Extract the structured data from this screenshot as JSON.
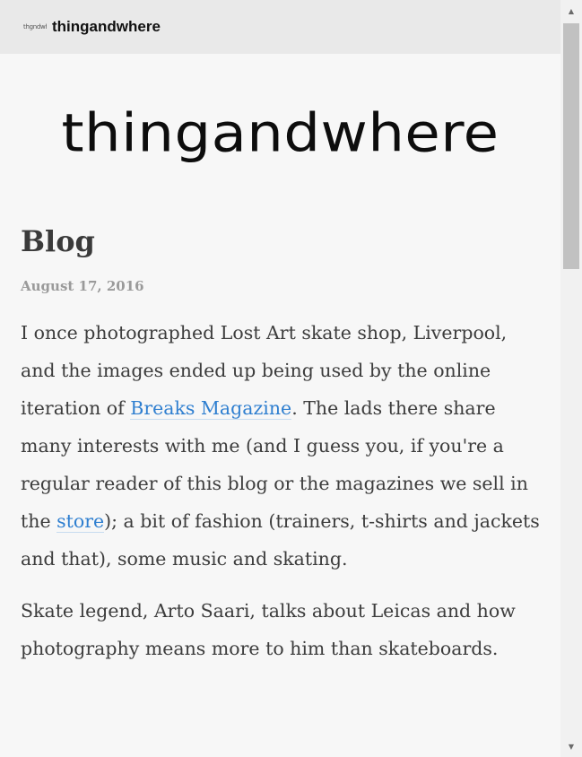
{
  "header": {
    "favicon_text": "thgndwhre",
    "site_name": "thingandwhere"
  },
  "logo": {
    "text": "thingandwhere"
  },
  "page": {
    "title": "Blog"
  },
  "post": {
    "date": "August 17, 2016",
    "p1_before": "I once photographed Lost Art skate shop, Liverpool, and the images ended up being used by the online iteration of ",
    "link_breaks": "Breaks Magazine",
    "p1_middle": ". The lads there share many interests with me (and I guess you, if you're a regular reader of this blog or the magazines we sell in the ",
    "link_store": "store",
    "p1_after": "); a bit of fashion (trainers, t-shirts and jackets and that), some music and skating.",
    "p2": "Skate legend, Arto Saari, talks about Leicas and how photography means more to him than skateboards."
  },
  "scrollbar": {
    "up_icon": "triangle-up-icon",
    "down_icon": "triangle-down-icon",
    "position_fraction": 0
  },
  "colors": {
    "link": "#2f7fd0",
    "text": "#3d3d3d",
    "date": "#9a9a9a",
    "header_bg": "#e9e9e9",
    "page_bg": "#f7f7f7"
  }
}
